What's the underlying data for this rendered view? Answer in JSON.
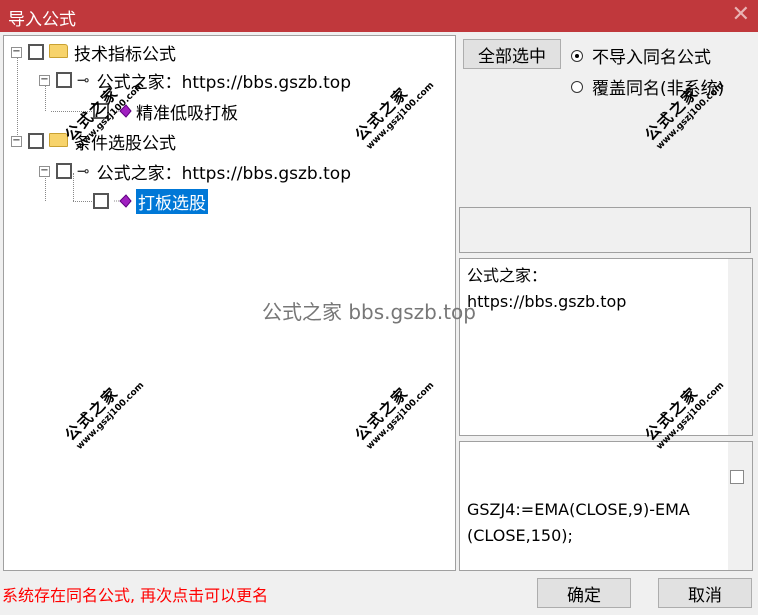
{
  "window": {
    "title": "导入公式",
    "close_glyph": "✕"
  },
  "tree": {
    "items": [
      {
        "label": "技术指标公式"
      },
      {
        "label": "公式之家：https://bbs.gszb.top"
      },
      {
        "label": "精准低吸打板"
      },
      {
        "label": "条件选股公式"
      },
      {
        "label": "公式之家：https://bbs.gszb.top"
      },
      {
        "label": "打板选股"
      }
    ]
  },
  "buttons": {
    "select_all": "全部选中",
    "ok": "确定",
    "cancel": "取消"
  },
  "options": {
    "no_import": "不导入同名公式",
    "overwrite": "覆盖同名(非系统)",
    "selected": "no_import"
  },
  "info": {
    "line1": "公式之家：",
    "line2": "https://bbs.gszb.top"
  },
  "code": {
    "line1": "GSZJ4:=EMA(CLOSE,9)-EMA",
    "line2": "(CLOSE,150);"
  },
  "status": "系统存在同名公式, 再次点击可以更名",
  "watermark": {
    "center": "公式之家 bbs.gszb.top",
    "stamp_title": "公式之家",
    "stamp_url": "www.gszj100.com"
  },
  "icons": {
    "expander": "minus-box",
    "folder": "folder-icon",
    "key": "key-icon",
    "gem": "purple-gem-icon"
  }
}
